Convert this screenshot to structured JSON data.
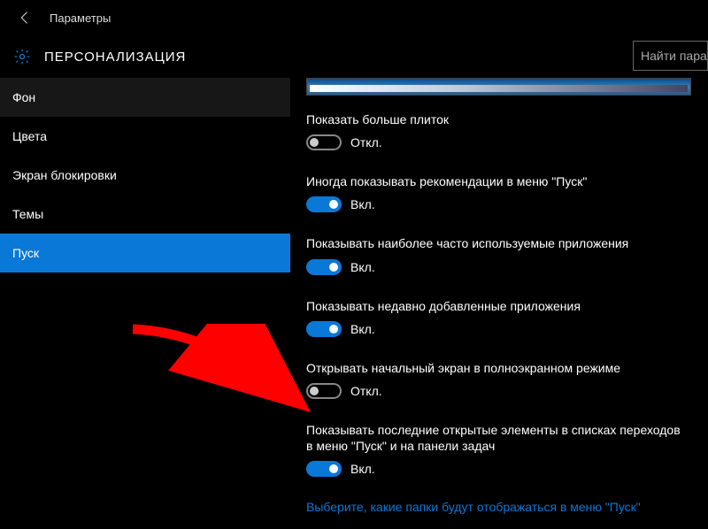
{
  "header": {
    "breadcrumb": "Параметры",
    "page_title": "ПЕРСОНАЛИЗАЦИЯ",
    "search_placeholder": "Найти параметр"
  },
  "sidebar": {
    "items": [
      {
        "label": "Фон",
        "state": "hover"
      },
      {
        "label": "Цвета",
        "state": ""
      },
      {
        "label": "Экран блокировки",
        "state": ""
      },
      {
        "label": "Темы",
        "state": ""
      },
      {
        "label": "Пуск",
        "state": "selected"
      }
    ]
  },
  "toggle_states": {
    "on": "Вкл.",
    "off": "Откл."
  },
  "settings": [
    {
      "label": "Показать больше плиток",
      "on": false
    },
    {
      "label": "Иногда показывать рекомендации в меню \"Пуск\"",
      "on": true
    },
    {
      "label": "Показывать наиболее часто используемые приложения",
      "on": true
    },
    {
      "label": "Показывать недавно добавленные приложения",
      "on": true
    },
    {
      "label": "Открывать начальный экран в полноэкранном режиме",
      "on": false
    },
    {
      "label": "Показывать последние открытые элементы в списках переходов в меню \"Пуск\" и на панели задач",
      "on": true
    }
  ],
  "link": "Выберите, какие папки будут отображаться в меню \"Пуск\"",
  "colors": {
    "accent": "#0a78d6"
  }
}
